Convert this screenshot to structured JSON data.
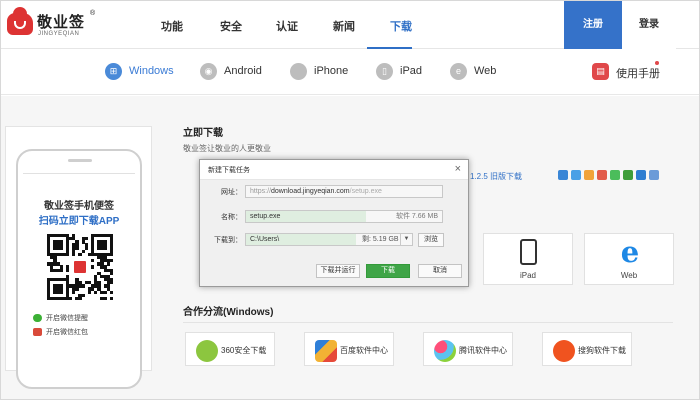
{
  "header": {
    "logo_name": "敬业签",
    "logo_reg": "®",
    "logo_sub": "JINGYEQIAN",
    "nav": [
      "功能",
      "安全",
      "认证",
      "新闻",
      "下载"
    ],
    "nav_active": "下载",
    "register": "注册",
    "login": "登录"
  },
  "platforms": {
    "items": [
      {
        "label": "Windows",
        "icon": "windows-icon"
      },
      {
        "label": "Android",
        "icon": "android-icon"
      },
      {
        "label": "iPhone",
        "icon": "apple-icon"
      },
      {
        "label": "iPad",
        "icon": "ipad-icon"
      },
      {
        "label": "Web",
        "icon": "web-icon"
      }
    ],
    "active": "Windows",
    "manual": "使用手册"
  },
  "phone": {
    "title": "敬业签手机便签",
    "cta": "扫码立即下载APP",
    "wechat_reminder": "开启微信提醒",
    "wechat_redpacket": "开启微信红包"
  },
  "main": {
    "download_title": "立即下载",
    "subtitle": "敬业签让敬业的人更敬业",
    "version_link": "1.2.5 旧版下载",
    "tiles": [
      "iPad",
      "Web"
    ],
    "partner_title": "合作分流(Windows)",
    "partners": [
      {
        "label": "360安全下载",
        "color": "#8cc63f"
      },
      {
        "label": "百度软件中心",
        "color": "#2f7fd8"
      },
      {
        "label": "腾讯软件中心",
        "color": "#ff4f7a"
      },
      {
        "label": "搜狗软件下载",
        "color": "#f0531f"
      }
    ]
  },
  "dialog": {
    "title": "新建下载任务",
    "close": "×",
    "url_label": "网址：",
    "url_pre": "https://",
    "url_main": "download.jingyeqian.com",
    "url_post": "/setup.exe",
    "name_label": "名称：",
    "name_value": "setup.exe",
    "name_size": "软件 7.66 MB",
    "path_label": "下载到：",
    "path_value": "C:\\Users\\",
    "path_size": "剩: 5.19 GB",
    "browse": "浏览",
    "download_run": "下载并运行",
    "download": "下载",
    "cancel": "取消"
  },
  "colors": {
    "brand_blue": "#3572c9",
    "link_blue": "#2f6fc6",
    "logo_red": "#dd3333",
    "download_green": "#3fa547"
  }
}
